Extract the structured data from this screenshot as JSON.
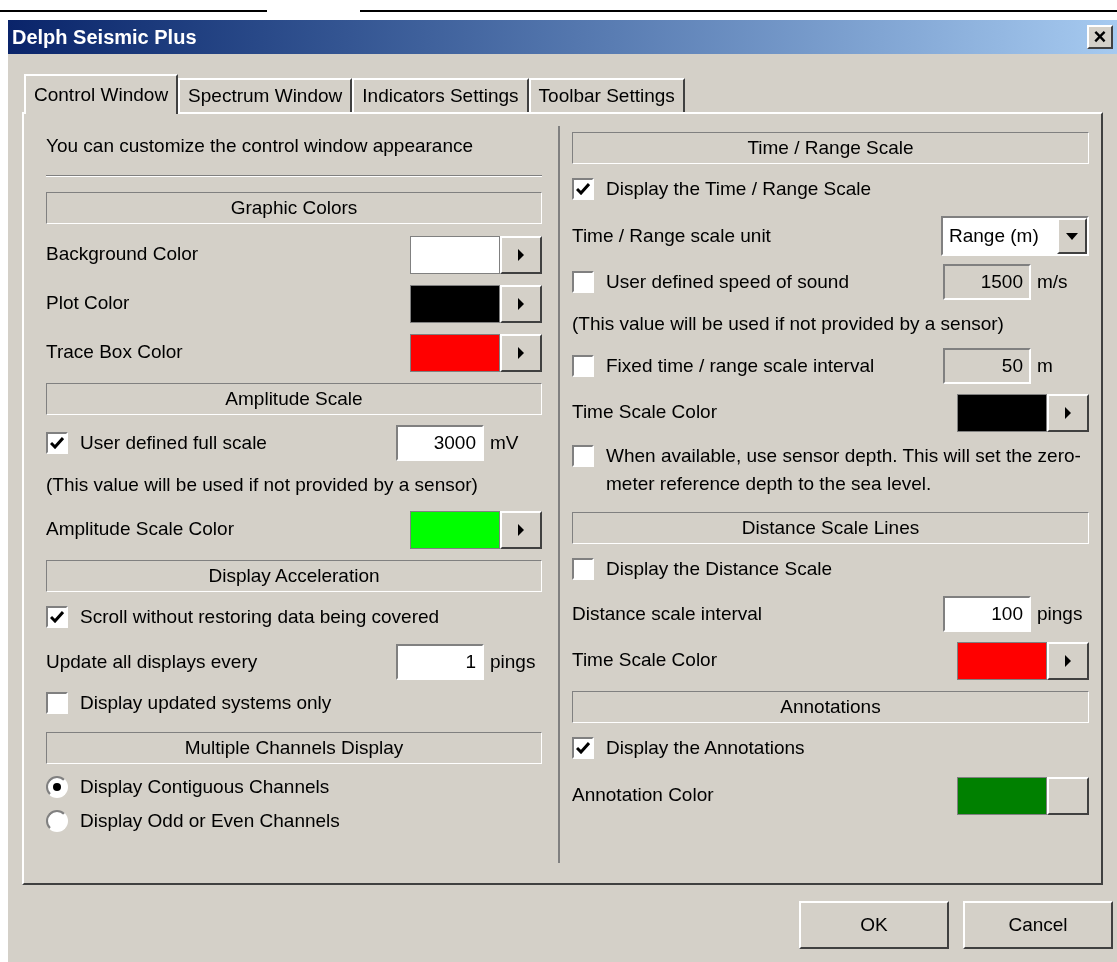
{
  "window": {
    "title": "Delph Seismic Plus",
    "close": "×"
  },
  "tabs": [
    {
      "label": "Control Window",
      "selected": true
    },
    {
      "label": "Spectrum Window",
      "selected": false
    },
    {
      "label": "Indicators Settings",
      "selected": false
    },
    {
      "label": "Toolbar Settings",
      "selected": false
    }
  ],
  "left": [
    {
      "kind": "text",
      "text": "You can customize the control window appearance"
    },
    {
      "kind": "rule"
    },
    {
      "kind": "heading",
      "text": "Graphic Colors"
    },
    {
      "kind": "color",
      "label": "Background Color",
      "color": "#ffffff",
      "arrow": true
    },
    {
      "kind": "color",
      "label": "Plot Color",
      "color": "#000000",
      "arrow": true
    },
    {
      "kind": "color",
      "label": "Trace Box Color",
      "color": "#ff0000",
      "arrow": true
    },
    {
      "kind": "heading",
      "text": "Amplitude Scale"
    },
    {
      "kind": "checkfield",
      "label": "User defined full scale",
      "checked": true,
      "value": "3000",
      "unit": "mV"
    },
    {
      "kind": "text",
      "text": "(This value will be used if not provided by a sensor)"
    },
    {
      "kind": "color",
      "label": "Amplitude Scale Color",
      "color": "#00ff00",
      "arrow": true
    },
    {
      "kind": "heading",
      "text": "Display Acceleration"
    },
    {
      "kind": "checkbox",
      "label": "Scroll without restoring data being covered",
      "checked": true
    },
    {
      "kind": "field",
      "label": "Update all displays every",
      "value": "1",
      "unit": "pings"
    },
    {
      "kind": "checkbox",
      "label": "Display updated systems only",
      "checked": false
    },
    {
      "kind": "heading",
      "text": "Multiple Channels Display"
    },
    {
      "kind": "radio",
      "label": "Display Contiguous Channels",
      "selected": true
    },
    {
      "kind": "radio",
      "label": "Display Odd or Even Channels",
      "selected": false
    }
  ],
  "right": [
    {
      "kind": "heading",
      "text": "Time / Range Scale"
    },
    {
      "kind": "checkbox",
      "label": "Display the Time / Range Scale",
      "checked": true
    },
    {
      "kind": "select",
      "label": "Time / Range scale unit",
      "value": "Range (m)"
    },
    {
      "kind": "checkfield",
      "label": "User defined speed of sound",
      "checked": false,
      "value": "1500",
      "unit": "m/s"
    },
    {
      "kind": "text",
      "text": "(This value will be used if not provided by a sensor)"
    },
    {
      "kind": "checkfield",
      "label": "Fixed time / range scale interval",
      "checked": false,
      "value": "50",
      "unit": "m"
    },
    {
      "kind": "color",
      "label": "Time Scale Color",
      "color": "#000000",
      "arrow": true
    },
    {
      "kind": "checkbox",
      "label": "When available, use sensor depth. This will set the zero-meter reference depth to the sea level.",
      "checked": false
    },
    {
      "kind": "heading",
      "text": "Distance Scale Lines"
    },
    {
      "kind": "checkbox",
      "label": "Display the Distance Scale",
      "checked": false
    },
    {
      "kind": "field",
      "label": "Distance scale interval",
      "value": "100",
      "unit": "pings"
    },
    {
      "kind": "color",
      "label": "Time Scale Color",
      "color": "#ff0000",
      "arrow": true
    },
    {
      "kind": "heading",
      "text": "Annotations"
    },
    {
      "kind": "checkbox",
      "label": "Display the Annotations",
      "checked": true
    },
    {
      "kind": "color",
      "label": "Annotation Color",
      "color": "#008000",
      "arrow": false
    }
  ],
  "buttons": [
    "OK",
    "Cancel"
  ]
}
